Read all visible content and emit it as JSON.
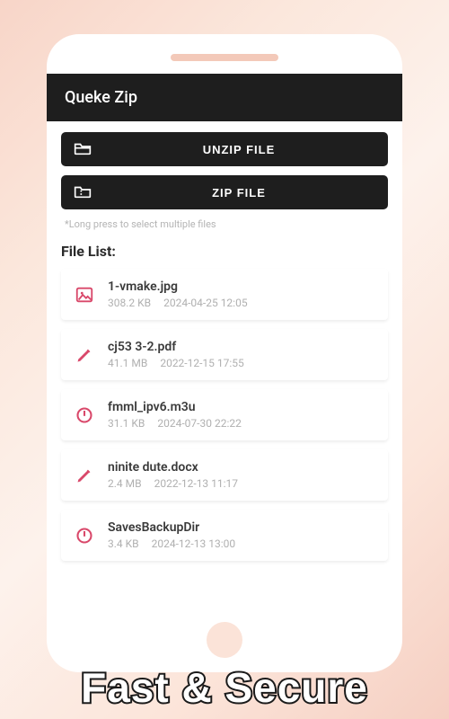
{
  "app": {
    "title": "Queke Zip"
  },
  "buttons": {
    "unzip": "UNZIP FILE",
    "zip": "ZIP FILE"
  },
  "hint": "*Long press to select multiple files",
  "list_title": "File List:",
  "files": [
    {
      "icon": "image",
      "name": "1-vmake.jpg",
      "size": "308.2 KB",
      "date": "2024-04-25 12:05"
    },
    {
      "icon": "pencil",
      "name": "cj53 3-2.pdf",
      "size": "41.1 MB",
      "date": "2022-12-15 17:55"
    },
    {
      "icon": "power",
      "name": "fmml_ipv6.m3u",
      "size": "31.1 KB",
      "date": "2024-07-30 22:22"
    },
    {
      "icon": "pencil",
      "name": "ninite dute.docx",
      "size": "2.4 MB",
      "date": "2022-12-13 11:17"
    },
    {
      "icon": "power",
      "name": "SavesBackupDir",
      "size": "3.4 KB",
      "date": "2024-12-13 13:00"
    }
  ],
  "tagline": "Fast & Secure",
  "colors": {
    "accent": "#d9486a"
  }
}
